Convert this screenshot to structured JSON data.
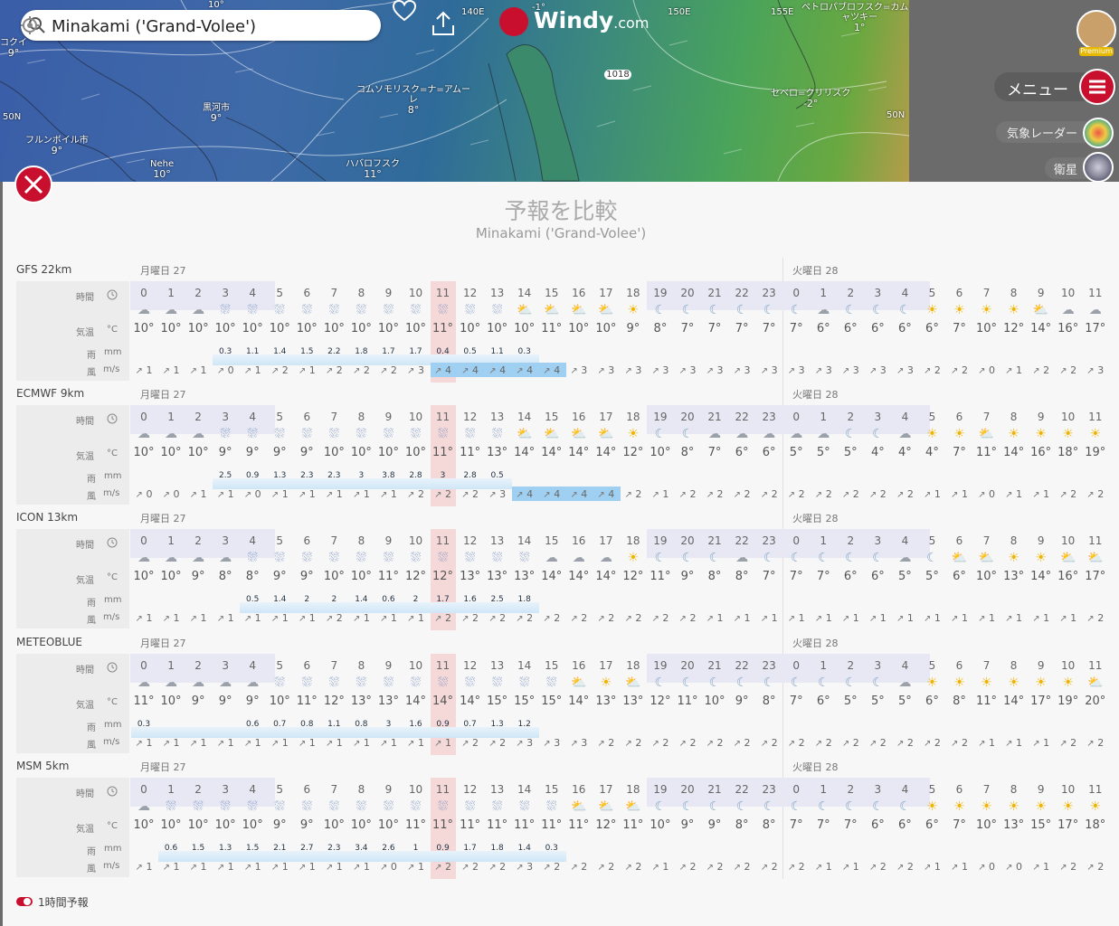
{
  "search": {
    "value": "Minakami ('Grand-Volee')"
  },
  "logo": {
    "text": "Windy",
    "suffix": ".com"
  },
  "map": {
    "lat_labels": [
      "50N",
      "50N"
    ],
    "lon_labels": [
      "140E",
      "150E",
      "155E",
      "10°",
      "-1°"
    ],
    "pressure": "1018",
    "cities": [
      {
        "name": "コクイ",
        "temp": "9°"
      },
      {
        "name": "黒河市",
        "temp": "9°"
      },
      {
        "name": "フルンボイル市",
        "temp": "9°"
      },
      {
        "name": "Nehe",
        "temp": "10°"
      },
      {
        "name": "ハバロフスク",
        "temp": "11°"
      },
      {
        "name": "コムソモリスク=ナ=アムー\nレ",
        "temp": "8°"
      },
      {
        "name": "ペトロパブロフスク=カムチ\nャツキー",
        "temp": "1°"
      },
      {
        "name": "セベロ=クリリスク",
        "temp": "-2°"
      }
    ]
  },
  "right": {
    "premium": "Premium",
    "menu": "メニュー",
    "radar": "気象レーダー",
    "satellite": "衛星"
  },
  "panel": {
    "title": "予報を比較",
    "subtitle": "Minakami ('Grand-Volee')",
    "day0": "月曜日 27",
    "day1": "火曜日 28",
    "row_labels": {
      "time": "時間",
      "temp": "気温",
      "temp_unit": "°C",
      "rain": "雨",
      "rain_unit": "mm",
      "wind": "風",
      "wind_unit": "m/s"
    },
    "hours": [
      "0",
      "1",
      "2",
      "3",
      "4",
      "5",
      "6",
      "7",
      "8",
      "9",
      "10",
      "11",
      "12",
      "13",
      "14",
      "15",
      "16",
      "17",
      "18",
      "19",
      "20",
      "21",
      "22",
      "23",
      "0",
      "1",
      "2",
      "3",
      "4",
      "5",
      "6",
      "7",
      "8",
      "9",
      "10",
      "11"
    ],
    "toggle": "1時間予報"
  },
  "models": [
    {
      "name": "GFS 22km",
      "wx": [
        "c",
        "c",
        "c",
        "r",
        "r",
        "r",
        "r",
        "r",
        "r",
        "r",
        "r",
        "r",
        "r",
        "r",
        "pc",
        "pc",
        "pc",
        "pc",
        "s",
        "n",
        "n",
        "n",
        "n",
        "n",
        "n",
        "c",
        "n",
        "n",
        "n",
        "s",
        "s",
        "s",
        "s",
        "pc",
        "c",
        "c"
      ],
      "temps": [
        "10°",
        "10°",
        "10°",
        "10°",
        "10°",
        "10°",
        "10°",
        "10°",
        "10°",
        "10°",
        "10°",
        "11°",
        "10°",
        "10°",
        "10°",
        "11°",
        "10°",
        "10°",
        "9°",
        "8°",
        "7°",
        "7°",
        "7°",
        "7°",
        "7°",
        "6°",
        "6°",
        "6°",
        "6°",
        "6°",
        "7°",
        "10°",
        "12°",
        "14°",
        "16°",
        "17°"
      ],
      "rain": [
        "",
        "",
        "",
        "0.3",
        "1.1",
        "1.4",
        "1.5",
        "2.2",
        "1.8",
        "1.7",
        "1.7",
        "0.4",
        "0.5",
        "1.1",
        "0.3",
        "",
        "",
        "",
        "",
        "",
        "",
        "",
        "",
        "",
        "",
        "",
        "",
        "",
        "",
        "",
        "",
        "",
        "",
        "",
        "",
        ""
      ],
      "wind": [
        "1",
        "1",
        "1",
        "0",
        "1",
        "2",
        "1",
        "2",
        "2",
        "2",
        "3",
        "4",
        "4",
        "4",
        "4",
        "4",
        "3",
        "3",
        "3",
        "3",
        "3",
        "3",
        "3",
        "3",
        "3",
        "3",
        "3",
        "3",
        "3",
        "2",
        "2",
        "0",
        "1",
        "2",
        "2",
        "3"
      ]
    },
    {
      "name": "ECMWF 9km",
      "wx": [
        "c",
        "c",
        "c",
        "r",
        "r",
        "r",
        "r",
        "r",
        "r",
        "r",
        "r",
        "r",
        "r",
        "r",
        "pc",
        "pc",
        "pc",
        "pc",
        "s",
        "n",
        "n",
        "c",
        "c",
        "c",
        "c",
        "c",
        "n",
        "n",
        "c",
        "s",
        "s",
        "pc",
        "s",
        "s",
        "s",
        "s"
      ],
      "temps": [
        "10°",
        "10°",
        "10°",
        "9°",
        "9°",
        "9°",
        "9°",
        "10°",
        "10°",
        "10°",
        "10°",
        "11°",
        "11°",
        "13°",
        "14°",
        "14°",
        "14°",
        "14°",
        "12°",
        "10°",
        "8°",
        "7°",
        "6°",
        "6°",
        "5°",
        "5°",
        "5°",
        "4°",
        "4°",
        "4°",
        "7°",
        "11°",
        "14°",
        "16°",
        "18°",
        "19°"
      ],
      "rain": [
        "",
        "",
        "",
        "2.5",
        "0.9",
        "1.3",
        "2.3",
        "2.3",
        "3",
        "3.8",
        "2.8",
        "3",
        "2.8",
        "0.5",
        "",
        "",
        "",
        "",
        "",
        "",
        "",
        "",
        "",
        "",
        "",
        "",
        "",
        "",
        "",
        "",
        "",
        "",
        "",
        "",
        "",
        ""
      ],
      "wind": [
        "0",
        "0",
        "1",
        "1",
        "0",
        "1",
        "1",
        "1",
        "1",
        "1",
        "2",
        "2",
        "2",
        "3",
        "4",
        "4",
        "4",
        "4",
        "2",
        "1",
        "2",
        "2",
        "2",
        "2",
        "2",
        "2",
        "2",
        "2",
        "2",
        "1",
        "1",
        "0",
        "1",
        "1",
        "2",
        "2"
      ]
    },
    {
      "name": "ICON 13km",
      "wx": [
        "c",
        "c",
        "c",
        "c",
        "r",
        "r",
        "r",
        "r",
        "r",
        "r",
        "r",
        "r",
        "r",
        "r",
        "r",
        "c",
        "c",
        "c",
        "s",
        "n",
        "n",
        "n",
        "c",
        "n",
        "n",
        "n",
        "n",
        "n",
        "c",
        "n",
        "pc",
        "pc",
        "s",
        "s",
        "pc",
        "pc"
      ],
      "temps": [
        "10°",
        "10°",
        "9°",
        "8°",
        "8°",
        "9°",
        "9°",
        "10°",
        "10°",
        "11°",
        "12°",
        "12°",
        "13°",
        "13°",
        "13°",
        "14°",
        "14°",
        "14°",
        "12°",
        "11°",
        "9°",
        "8°",
        "8°",
        "7°",
        "7°",
        "7°",
        "6°",
        "6°",
        "5°",
        "5°",
        "6°",
        "10°",
        "13°",
        "14°",
        "16°",
        "17°"
      ],
      "rain": [
        "",
        "",
        "",
        "",
        "0.5",
        "1.4",
        "2",
        "2",
        "1.4",
        "0.6",
        "2",
        "1.7",
        "1.6",
        "2.5",
        "1.8",
        "",
        "",
        "",
        "",
        "",
        "",
        "",
        "",
        "",
        "",
        "",
        "",
        "",
        "",
        "",
        "",
        "",
        "",
        "",
        "",
        ""
      ],
      "wind": [
        "1",
        "1",
        "1",
        "1",
        "1",
        "1",
        "1",
        "2",
        "1",
        "1",
        "1",
        "2",
        "2",
        "2",
        "2",
        "2",
        "2",
        "2",
        "2",
        "2",
        "2",
        "1",
        "1",
        "1",
        "1",
        "1",
        "1",
        "1",
        "1",
        "1",
        "1",
        "1",
        "1",
        "1",
        "1",
        "2"
      ]
    },
    {
      "name": "METEOBLUE",
      "wx": [
        "c",
        "c",
        "c",
        "c",
        "c",
        "r",
        "r",
        "r",
        "r",
        "r",
        "r",
        "r",
        "r",
        "r",
        "r",
        "r",
        "pc",
        "s",
        "pc",
        "n",
        "n",
        "n",
        "n",
        "n",
        "n",
        "n",
        "n",
        "n",
        "c",
        "s",
        "s",
        "s",
        "s",
        "s",
        "s",
        "pc"
      ],
      "temps": [
        "11°",
        "10°",
        "9°",
        "9°",
        "9°",
        "10°",
        "11°",
        "12°",
        "13°",
        "13°",
        "14°",
        "14°",
        "14°",
        "15°",
        "15°",
        "15°",
        "14°",
        "13°",
        "13°",
        "12°",
        "11°",
        "10°",
        "9°",
        "8°",
        "7°",
        "6°",
        "5°",
        "5°",
        "5°",
        "6°",
        "8°",
        "11°",
        "14°",
        "17°",
        "19°",
        "20°"
      ],
      "rain": [
        "0.3",
        "",
        "",
        "",
        "0.6",
        "0.7",
        "0.8",
        "1.1",
        "0.8",
        "3",
        "1.6",
        "0.9",
        "0.7",
        "1.3",
        "1.2",
        "",
        "",
        "",
        "",
        "",
        "",
        "",
        "",
        "",
        "",
        "",
        "",
        "",
        "",
        "",
        "",
        "",
        "",
        "",
        "",
        ""
      ],
      "wind": [
        "1",
        "1",
        "1",
        "1",
        "1",
        "1",
        "1",
        "1",
        "1",
        "1",
        "1",
        "1",
        "2",
        "2",
        "3",
        "3",
        "3",
        "2",
        "2",
        "2",
        "2",
        "2",
        "2",
        "2",
        "2",
        "2",
        "2",
        "2",
        "2",
        "2",
        "2",
        "1",
        "1",
        "1",
        "2",
        "2"
      ]
    },
    {
      "name": "MSM 5km",
      "wx": [
        "c",
        "r",
        "r",
        "r",
        "r",
        "r",
        "r",
        "r",
        "r",
        "r",
        "r",
        "r",
        "r",
        "r",
        "r",
        "r",
        "pc",
        "pc",
        "pc",
        "n",
        "n",
        "n",
        "n",
        "n",
        "n",
        "n",
        "n",
        "n",
        "n",
        "s",
        "s",
        "s",
        "s",
        "s",
        "s",
        "s"
      ],
      "temps": [
        "10°",
        "10°",
        "10°",
        "10°",
        "10°",
        "9°",
        "9°",
        "10°",
        "10°",
        "10°",
        "11°",
        "11°",
        "11°",
        "11°",
        "11°",
        "11°",
        "11°",
        "12°",
        "11°",
        "10°",
        "9°",
        "9°",
        "8°",
        "8°",
        "7°",
        "7°",
        "7°",
        "6°",
        "6°",
        "6°",
        "7°",
        "10°",
        "13°",
        "15°",
        "17°",
        "18°"
      ],
      "rain": [
        "",
        "0.6",
        "1.5",
        "1.3",
        "1.5",
        "2.1",
        "2.7",
        "2.3",
        "3.4",
        "2.6",
        "1",
        "0.9",
        "1.7",
        "1.8",
        "1.4",
        "0.3",
        "",
        "",
        "",
        "",
        "",
        "",
        "",
        "",
        "",
        "",
        "",
        "",
        "",
        "",
        "",
        "",
        "",
        "",
        "",
        ""
      ],
      "wind": [
        "1",
        "1",
        "1",
        "1",
        "1",
        "1",
        "1",
        "1",
        "1",
        "0",
        "1",
        "2",
        "2",
        "2",
        "3",
        "2",
        "2",
        "2",
        "2",
        "1",
        "2",
        "2",
        "2",
        "2",
        "2",
        "1",
        "1",
        "2",
        "2",
        "1",
        "1",
        "0",
        "0",
        "1",
        "2",
        "2"
      ]
    }
  ]
}
